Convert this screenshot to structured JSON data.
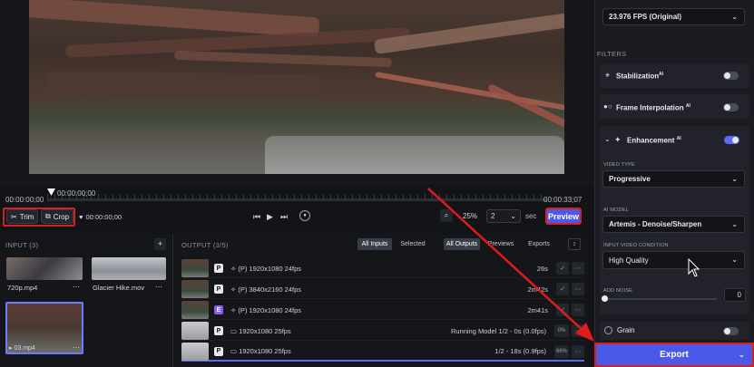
{
  "timeline": {
    "current": "00:00:00;00",
    "playhead_time": "00:00:00;00",
    "end": "00:00:33;07"
  },
  "controls": {
    "trim_label": "Trim",
    "crop_label": "Crop",
    "marker_time": "00:00:00;00",
    "zoom": "25%",
    "step_value": "2",
    "step_unit": "sec",
    "preview_label": "Preview"
  },
  "input_panel": {
    "header": "INPUT (3)",
    "add": "+",
    "files": [
      {
        "name": "720p.mp4"
      },
      {
        "name": "Glacier Hike.mov"
      },
      {
        "name": "03.mp4"
      }
    ]
  },
  "output_panel": {
    "header": "OUTPUT (3/5)",
    "filters_a": [
      "All Inputs",
      "Selected"
    ],
    "filters_b": [
      "All Outputs",
      "Previews",
      "Exports"
    ],
    "rows": [
      {
        "badge": "P",
        "flag": "(P)",
        "spec": "1920x1080  24fps",
        "status": "26s"
      },
      {
        "badge": "P",
        "flag": "(P)",
        "spec": "3840x2160  24fps",
        "status": "2m42s"
      },
      {
        "badge": "E",
        "flag": "(P)",
        "spec": "1920x1080  24fps",
        "status": "2m41s"
      },
      {
        "badge": "P",
        "flag": "",
        "spec": "1920x1080  25fps",
        "status": "Running Model  1/2 - 0s (0.0fps)",
        "pct": "0%"
      },
      {
        "badge": "P",
        "flag": "",
        "spec": "1920x1080  25fps",
        "status": "1/2 -  18s  (0.9fps)",
        "pct": "66%"
      }
    ]
  },
  "sidebar": {
    "fps_value": "23.976 FPS (Original)",
    "filters_header": "FILTERS",
    "stabilization": "Stabilization",
    "frame_interpolation": "Frame Interpolation",
    "enhancement": "Enhancement",
    "ai_sup": "AI",
    "video_type_label": "VIDEO TYPE",
    "video_type_value": "Progressive",
    "ai_model_label": "AI MODEL",
    "ai_model_value": "Artemis - Denoise/Sharpen",
    "input_condition_label": "INPUT VIDEO CONDITION",
    "input_condition_value": "High Quality",
    "add_noise_label": "ADD NOISE",
    "add_noise_value": "0",
    "grain": "Grain",
    "export_label": "Export"
  }
}
